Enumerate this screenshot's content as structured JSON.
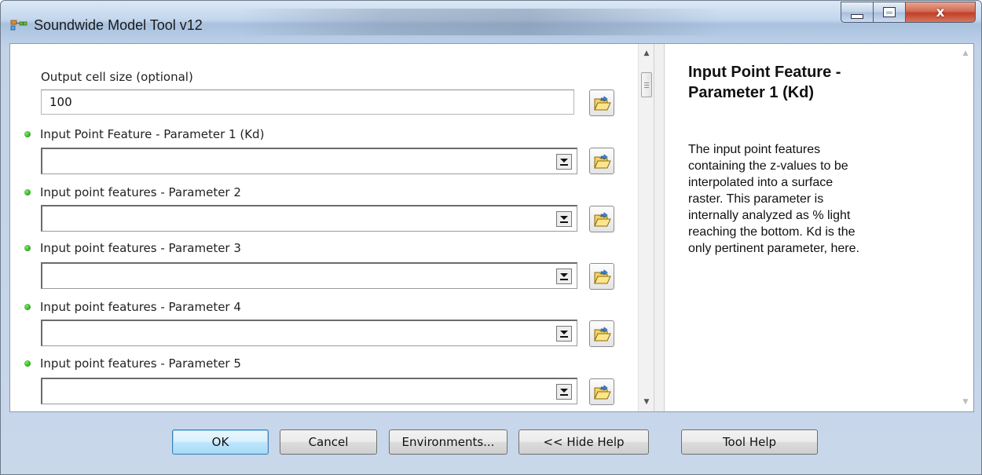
{
  "window": {
    "title": "Soundwide Model Tool v12",
    "controls": {
      "minimize": "minimize",
      "maximize": "maximize",
      "close": "x"
    }
  },
  "params": {
    "cell_size": {
      "label": "Output cell size (optional)",
      "value": "100"
    },
    "fields": [
      {
        "label": "Input Point Feature - Parameter 1 (Kd)",
        "value": ""
      },
      {
        "label": "Input point features - Parameter 2",
        "value": ""
      },
      {
        "label": "Input point features - Parameter 3",
        "value": ""
      },
      {
        "label": "Input point features - Parameter 4",
        "value": ""
      },
      {
        "label": "Input point features - Parameter 5",
        "value": ""
      }
    ]
  },
  "help": {
    "title_lines": [
      "Input Point Feature -",
      "Parameter 1 (Kd)"
    ],
    "body_lines": [
      "The input point features",
      "containing the z-values to be",
      "interpolated into a surface",
      "raster. This parameter is",
      "internally analyzed as % light",
      "reaching the bottom. Kd is the",
      "only pertinent parameter, here."
    ]
  },
  "buttons": {
    "ok": "OK",
    "cancel": "Cancel",
    "environments": "Environments...",
    "hide_help": "<< Hide Help",
    "tool_help": "Tool Help"
  },
  "colors": {
    "required_dot": "#2ea81c",
    "default_button_border": "#3c7fb1",
    "close_button": "#c0402a"
  },
  "icons": {
    "browse": "folder-open-icon",
    "dropdown": "chevron-down-icon",
    "app": "model-tool-icon"
  }
}
